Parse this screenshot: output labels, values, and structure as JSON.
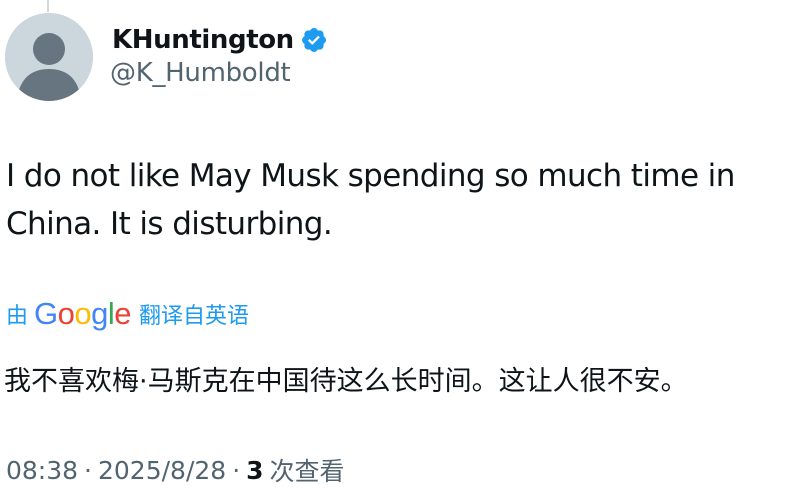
{
  "author": {
    "display_name": "KHuntington",
    "handle": "@K_Humboldt",
    "verified": true
  },
  "tweet": {
    "text": "I do not like May Musk spending so much time in\nChina. It is disturbing."
  },
  "translation": {
    "prefix": "由",
    "provider_letters": [
      "G",
      "o",
      "o",
      "g",
      "l",
      "e"
    ],
    "suffix": "翻译自英语",
    "text": "我不喜欢梅·马斯克在中国待这么长时间。这让人很不安。"
  },
  "meta": {
    "time": "08:38",
    "separator": "·",
    "date": "2025/8/28",
    "views_count": "3",
    "views_label": "次查看"
  },
  "colors": {
    "link": "#1d9bf0",
    "text": "#0f1419",
    "secondary": "#536471",
    "google_blue": "#4285f4",
    "google_red": "#ea4335",
    "google_yellow": "#fbbc05",
    "google_green": "#34a853"
  },
  "icons": {
    "verified": "verified-badge-icon",
    "avatar": "default-avatar-icon"
  }
}
